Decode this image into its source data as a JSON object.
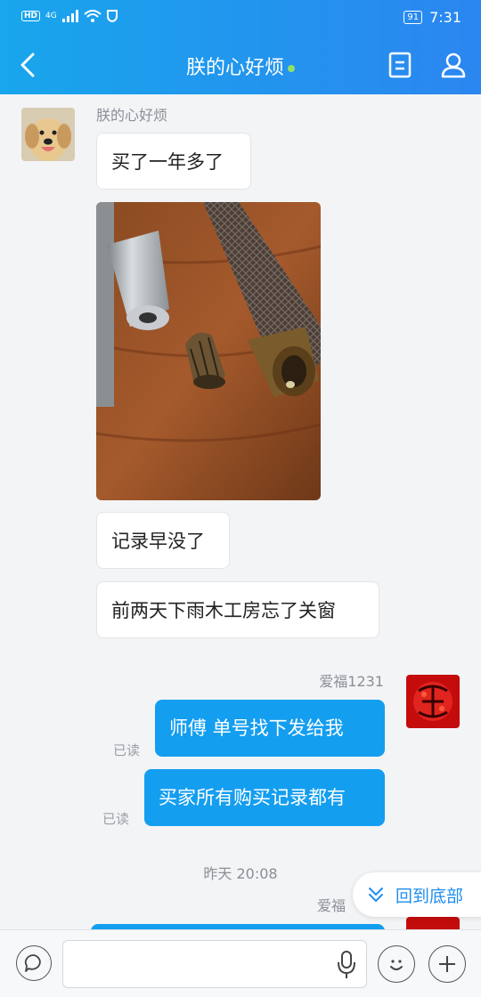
{
  "status_bar": {
    "network_badge": "HD",
    "network_type": "4G",
    "battery": "91",
    "time": "7:31"
  },
  "header": {
    "title": "朕的心好烦",
    "online": true,
    "accent_color": "#1e8ef0"
  },
  "messages": {
    "incoming_name": "朕的心好烦",
    "incoming": [
      "买了一年多了",
      "记录早没了",
      "前两天下雨木工房忘了关窗"
    ],
    "outgoing_name": "爱福1231",
    "outgoing": [
      "师傅  单号找下发给我",
      "买家所有购买记录都有"
    ],
    "read_label": "已读",
    "timestamp": "昨天 20:08",
    "outgoing_name_2": "爱福"
  },
  "goto_bottom_label": "回到底部",
  "icons": {
    "back": "chevron-left-icon",
    "doc": "document-icon",
    "profile": "person-icon",
    "chat": "speech-bubble-icon",
    "mic": "microphone-icon",
    "emoji": "emoji-icon",
    "plus": "plus-icon"
  }
}
